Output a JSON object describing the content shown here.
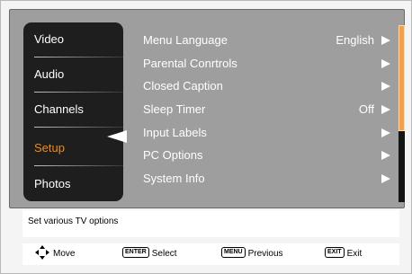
{
  "sidebar": {
    "items": [
      {
        "label": "Video"
      },
      {
        "label": "Audio"
      },
      {
        "label": "Channels"
      },
      {
        "label": "Setup"
      },
      {
        "label": "Photos"
      }
    ],
    "active": "Setup"
  },
  "menu": {
    "rows": [
      {
        "label": "Menu Language",
        "value": "English"
      },
      {
        "label": "Parental Conrtrols",
        "value": ""
      },
      {
        "label": "Closed Caption",
        "value": ""
      },
      {
        "label": "Sleep Timer",
        "value": "Off"
      },
      {
        "label": "Input Labels",
        "value": ""
      },
      {
        "label": "PC Options",
        "value": ""
      },
      {
        "label": "System Info",
        "value": ""
      }
    ]
  },
  "help": {
    "text": "Set various TV options"
  },
  "footer": {
    "move": "Move",
    "enter_key": "ENTER",
    "select": "Select",
    "menu_key": "MENU",
    "previous": "Previous",
    "exit_key": "EXIT",
    "exit": "Exit"
  },
  "colors": {
    "active": "#ee8c1e",
    "scrollbar": "#f3a04e",
    "panel": "#1e1e1e",
    "screen": "#9e9e9e"
  },
  "scroll": {
    "position_fraction": 0.6
  }
}
